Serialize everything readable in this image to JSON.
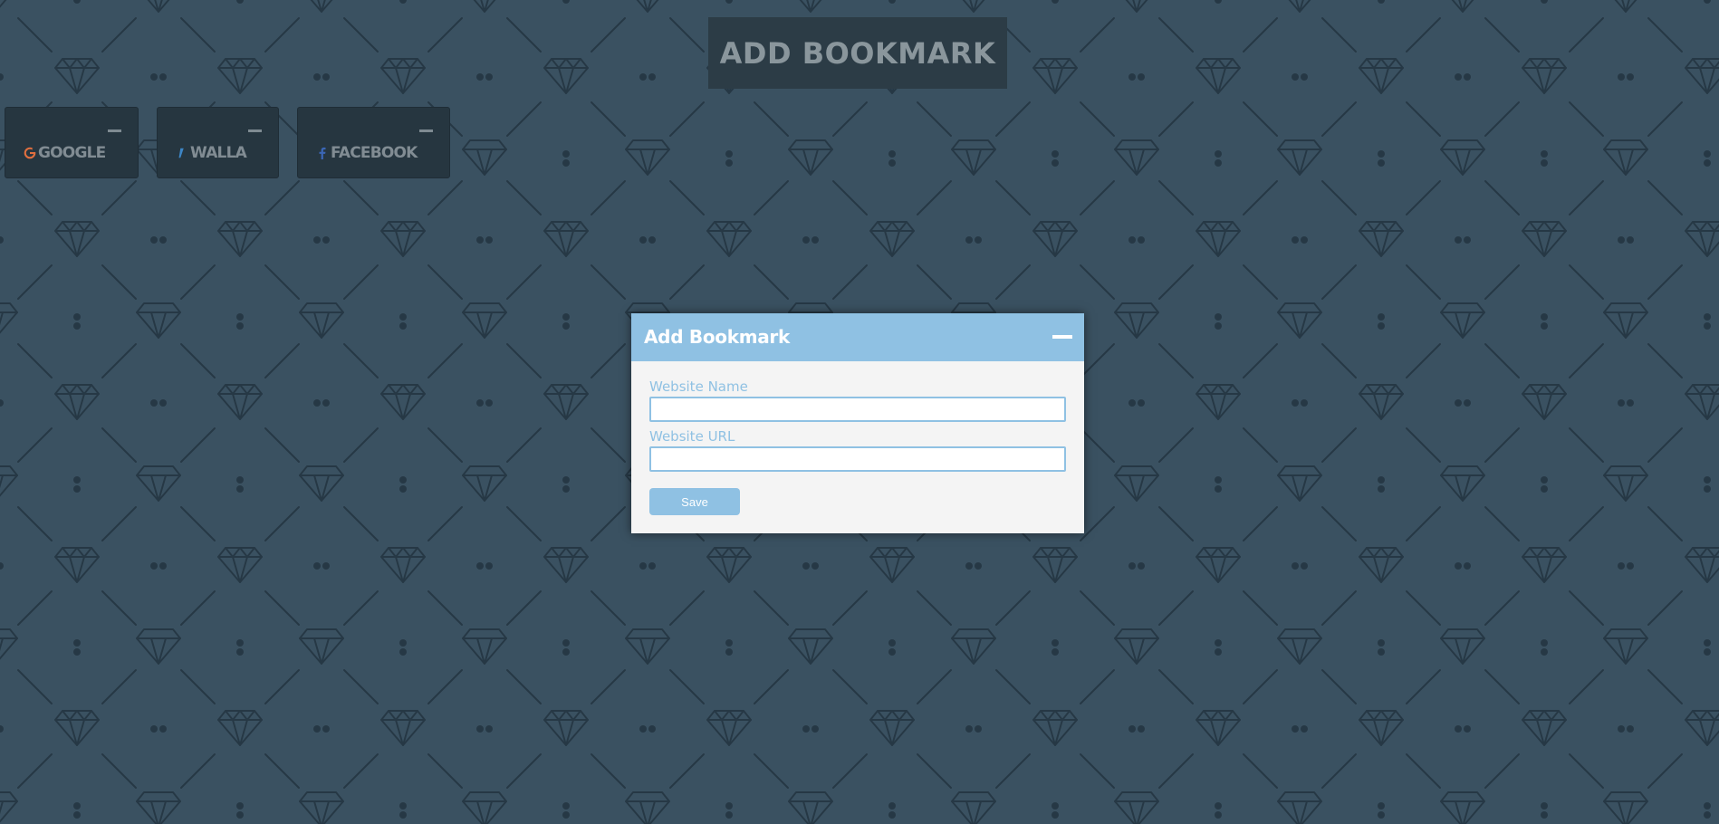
{
  "header": {
    "add_button_label": "ADD BOOKMARK"
  },
  "bookmarks": [
    {
      "label": "GOOGLE",
      "icon": "google-g-icon"
    },
    {
      "label": "WALLA",
      "icon": "walla-icon"
    },
    {
      "label": "FACEBOOK",
      "icon": "facebook-f-icon"
    }
  ],
  "modal": {
    "title": "Add Bookmark",
    "name_label": "Website Name",
    "name_value": "",
    "url_label": "Website URL",
    "url_value": "",
    "save_label": "Save"
  },
  "colors": {
    "background": "#3a5161",
    "pattern": "#263845",
    "tile": "#263640",
    "accent": "#8fc1e3",
    "modal_body": "#f4f4f4"
  }
}
